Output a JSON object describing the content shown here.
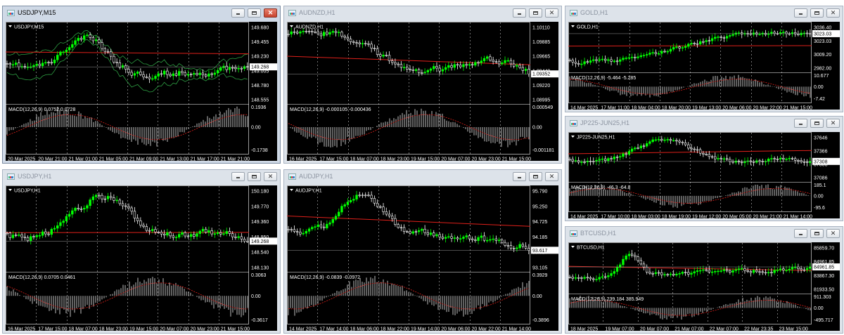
{
  "windows": [
    {
      "id": "usdjpy-m15",
      "title": "USDJPY,M15",
      "active": true,
      "symbol_label": "USDJPY,M15",
      "price_levels": [
        "149.680",
        "149.455",
        "149.230",
        "149.005",
        "148.780",
        "148.555"
      ],
      "current_price": "149.268",
      "indicator_label": "MACD(12,26,9) 0.0752 0.0728",
      "indicator_levels": [
        "0.1936",
        "0.00",
        "-0.1738"
      ],
      "time_labels": [
        "20 Mar 2025",
        "20 Mar 21:00",
        "21 Mar 01:00",
        "21 Mar 05:00",
        "21 Mar 09:00",
        "21 Mar 13:00",
        "21 Mar 17:00",
        "21 Mar 21:00"
      ],
      "overlays": [
        "bollinger",
        "ma"
      ]
    },
    {
      "id": "audnzd-h1",
      "title": "AUDNZD,H1",
      "active": false,
      "symbol_label": "AUDNZD,H1",
      "price_levels": [
        "1.10110",
        "1.09885",
        "1.09665",
        "1.09440",
        "1.09220",
        "1.08995"
      ],
      "current_price": "1.09352",
      "indicator_label": "MACD(12,26,9) -0.000105 -0.000436",
      "indicator_levels": [
        "0.000549",
        "0.00",
        "-0.001181"
      ],
      "time_labels": [
        "16 Mar 2025",
        "17 Mar 15:00",
        "18 Mar 07:00",
        "18 Mar 23:00",
        "19 Mar 15:00",
        "20 Mar 07:00",
        "20 Mar 23:00",
        "21 Mar 15:00"
      ],
      "overlays": [
        "ma"
      ]
    },
    {
      "id": "gold-h1",
      "title": "GOLD,H1",
      "active": false,
      "symbol_label": "GOLD,H1",
      "price_levels": [
        "3036.40",
        "3023.03",
        "3009.20",
        "2982.00"
      ],
      "current_price": "3023.03",
      "indicator_label": "MACD(12,26,9) -5.464 -5.285",
      "indicator_levels": [
        "10.677",
        "0.00",
        "-7.42"
      ],
      "time_labels": [
        "14 Mar 2025",
        "17 Mar 11:00",
        "18 Mar 04:00",
        "18 Mar 20:00",
        "19 Mar 13:00",
        "20 Mar 06:00",
        "20 Mar 22:00",
        "21 Mar 15:00"
      ],
      "overlays": [
        "ma"
      ]
    },
    {
      "id": "usdjpy-h1",
      "title": "USDJPY,H1",
      "active": false,
      "symbol_label": "USDJPY,H1",
      "price_levels": [
        "150.180",
        "149.770",
        "149.360",
        "148.950",
        "148.540",
        "148.130"
      ],
      "current_price": "149.268",
      "indicator_label": "MACD(12,26,9) 0.0705 0.0461",
      "indicator_levels": [
        "0.3063",
        "0.00",
        "-0.3617"
      ],
      "time_labels": [
        "16 Mar 2025",
        "17 Mar 15:00",
        "18 Mar 07:00",
        "18 Mar 23:00",
        "19 Mar 15:00",
        "20 Mar 07:00",
        "20 Mar 23:00",
        "21 Mar 15:00"
      ],
      "overlays": [
        "ma"
      ]
    },
    {
      "id": "audjpy-h1",
      "title": "AUDJPY,H1",
      "active": false,
      "symbol_label": "AUDJPY,H1",
      "price_levels": [
        "95.790",
        "95.250",
        "94.725",
        "94.185",
        "93.617",
        "93.105"
      ],
      "current_price": "93.617",
      "indicator_label": "MACD(12,26,9) -0.0839 -0.0972",
      "indicator_levels": [
        "0.3929",
        "0.00",
        "-0.3896"
      ],
      "time_labels": [
        "14 Mar 2025",
        "17 Mar 14:00",
        "18 Mar 06:00",
        "18 Mar 22:00",
        "19 Mar 14:00",
        "20 Mar 06:00",
        "20 Mar 22:00",
        "21 Mar 14:00"
      ],
      "overlays": [
        "ma"
      ]
    },
    {
      "id": "jp225-h1",
      "title": "JP225-JUN25,H1",
      "active": false,
      "symbol_label": "JP225-JUN25,H1",
      "price_levels": [
        "37646",
        "37366",
        "37308",
        "37086"
      ],
      "current_price": "37308",
      "indicator_label": "MACD(12,26,9) -46.3 -64.8",
      "indicator_levels": [
        "185.1",
        "0.00",
        "-95.6"
      ],
      "time_labels": [
        "14 Mar 2025",
        "17 Mar 10:00",
        "18 Mar 03:00",
        "18 Mar 19:00",
        "19 Mar 12:00",
        "20 Mar 05:00",
        "20 Mar 21:00",
        "21 Mar 14:00"
      ],
      "overlays": [
        "ma"
      ]
    },
    {
      "id": "btcusd-h1",
      "title": "BTCUSD,H1",
      "active": false,
      "symbol_label": "BTCUSD,H1",
      "price_levels": [
        "85859.70",
        "84961.85",
        "83867.30",
        "81933.50"
      ],
      "current_price": "84961.85",
      "indicator_label": "MACD(12,26,9) 239.184 385.949",
      "indicator_levels": [
        "911.303",
        "0.00",
        "-495.717"
      ],
      "time_labels": [
        "18 Mar 2025",
        "19 Mar 07:00",
        "20 Mar 07:00",
        "21 Mar 07:00",
        "22 Mar 07:00",
        "22 Mar 23:35",
        "23 Mar 15:00"
      ],
      "overlays": [
        "ma"
      ]
    }
  ],
  "colors": {
    "bull": "#00ff00",
    "bear": "#ffffff",
    "ma": "#e0201a",
    "bollinger": "#2ea043",
    "macd_hist": "#c0c0c0",
    "macd_signal": "#e0201a",
    "grid": "#ffffff",
    "price_tag_bg": "#ffffff"
  }
}
